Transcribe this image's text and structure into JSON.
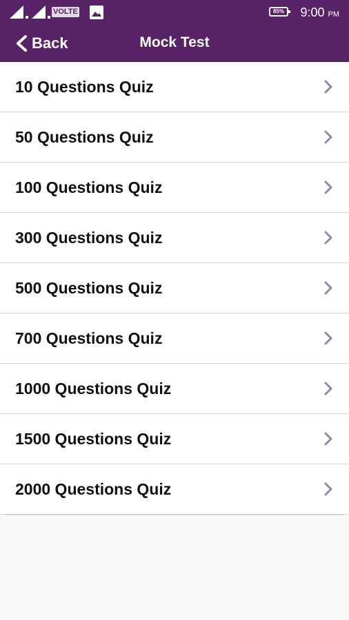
{
  "status_bar": {
    "network": "VOLTE",
    "battery": "85%",
    "time": "9:00",
    "ampm": "PM"
  },
  "toolbar": {
    "back_label": "Back",
    "title": "Mock Test"
  },
  "quiz_list": [
    {
      "label": "10 Questions Quiz"
    },
    {
      "label": "50 Questions Quiz"
    },
    {
      "label": "100 Questions Quiz"
    },
    {
      "label": "300 Questions Quiz"
    },
    {
      "label": "500 Questions Quiz"
    },
    {
      "label": "700 Questions Quiz"
    },
    {
      "label": "1000 Questions Quiz"
    },
    {
      "label": "1500 Questions Quiz"
    },
    {
      "label": "2000 Questions Quiz"
    }
  ],
  "colors": {
    "header_bg": "#582266",
    "chevron": "#8a8aa8"
  }
}
